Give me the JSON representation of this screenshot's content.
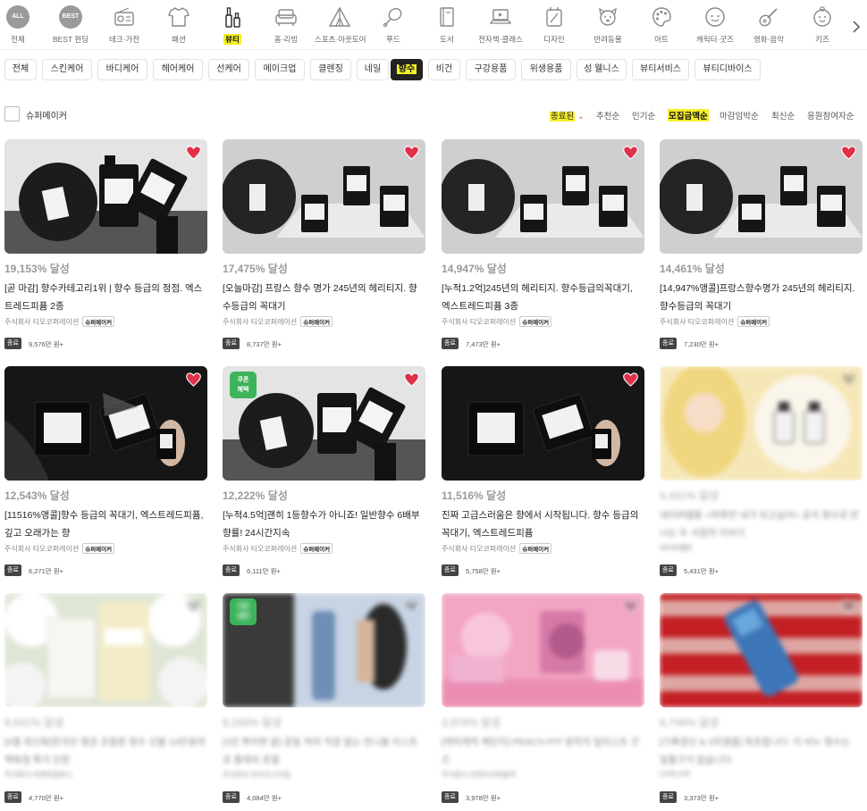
{
  "categories": [
    {
      "label": "전체",
      "icon": "all-icon"
    },
    {
      "label": "BEST 펀딩",
      "icon": "best-icon"
    },
    {
      "label": "테크·가전",
      "icon": "radio-icon"
    },
    {
      "label": "패션",
      "icon": "shirt-icon"
    },
    {
      "label": "뷰티",
      "icon": "cosmetics-icon",
      "active": true
    },
    {
      "label": "홈·리빙",
      "icon": "sofa-icon"
    },
    {
      "label": "스포츠·아웃도어",
      "icon": "tent-icon"
    },
    {
      "label": "푸드",
      "icon": "drumstick-icon"
    },
    {
      "label": "도서",
      "icon": "book-icon"
    },
    {
      "label": "전자책·클래스",
      "icon": "laptop-icon"
    },
    {
      "label": "디자인",
      "icon": "design-icon"
    },
    {
      "label": "반려동물",
      "icon": "dog-icon"
    },
    {
      "label": "아트",
      "icon": "palette-icon"
    },
    {
      "label": "캐릭터·굿즈",
      "icon": "character-icon"
    },
    {
      "label": "영화·음악",
      "icon": "guitar-icon"
    },
    {
      "label": "키즈",
      "icon": "kids-icon"
    }
  ],
  "all_badge": "ALL",
  "best_badge": "BEST",
  "subtabs": [
    "전체",
    "스킨케어",
    "바디케어",
    "헤어케어",
    "선케어",
    "메이크업",
    "클렌징",
    "네일",
    "향수",
    "비건",
    "구강용품",
    "위생용품",
    "성 웰니스",
    "뷰티서비스",
    "뷰티디바이스"
  ],
  "active_subtab": "향수",
  "filter": {
    "super_maker_label": "슈퍼메이커",
    "status_dropdown": "종료된",
    "sorts": [
      "추천순",
      "인기순",
      "모집금액순",
      "마감임박순",
      "최신순",
      "응원참여자순"
    ],
    "active_sort": "모집금액순"
  },
  "products": [
    {
      "pct": "19,153% 달성",
      "title": "[곧 마감] 향수카테고리1위 | 향수 등급의 정점. 엑스트레드피퓸 2종",
      "maker": "주식회사 티오코퍼레이션",
      "super": "슈퍼메이커",
      "status": "종료",
      "amount": "9,576만 원+",
      "liked": true
    },
    {
      "pct": "17,475% 달성",
      "title": "[오늘마감] 프랑스 향수 명가 245년의 헤리티지. 향수등급의 꼭대기",
      "maker": "주식회사 티오코퍼레이션",
      "super": "슈퍼메이커",
      "status": "종료",
      "amount": "8,737만 원+",
      "liked": true
    },
    {
      "pct": "14,947% 달성",
      "title": "[누적1.2억]245년의 헤리티지. 향수등급의꼭대기, 엑스트레드피퓸 3종",
      "maker": "주식회사 티오코퍼레이션",
      "super": "슈퍼메이커",
      "status": "종료",
      "amount": "7,473만 원+",
      "liked": true
    },
    {
      "pct": "14,461% 달성",
      "title": "[14,947%앵콜]프랑스향수명가 245년의 헤리티지. 향수등급의 꼭대기",
      "maker": "주식회사 티오코퍼레이션",
      "super": "슈퍼메이커",
      "status": "종료",
      "amount": "7,230만 원+",
      "liked": true
    },
    {
      "pct": "12,543% 달성",
      "title": "[11516%앵콜]향수 등급의 꼭대기, 엑스트레드피퓸, 깊고 오래가는 향",
      "maker": "주식회사 티오코퍼레이션",
      "super": "슈퍼메이커",
      "status": "종료",
      "amount": "6,271만 원+",
      "liked": true
    },
    {
      "pct": "12,222% 달성",
      "title": "[누적4.5억]괜히 1등향수가 아니죠! 일반향수 6배부향률! 24시간지속",
      "maker": "주식회사 티오코퍼레이션",
      "super": "슈퍼메이커",
      "status": "종료",
      "amount": "6,111만 원+",
      "liked": true,
      "coupon": "쿠폰\n혜택"
    },
    {
      "pct": "11,516% 달성",
      "title": "진짜 고급스러움은 향에서 시작됩니다. 향수 등급의 꼭대기, 엑스트레드피퓸",
      "maker": "주식회사 티오코퍼레이션",
      "super": "슈퍼메이커",
      "status": "종료",
      "amount": "5,758만 원+",
      "liked": true
    },
    {
      "pct": "5,431% 달성",
      "title": "네이버웹툰 <하루만 네가 되고싶어> 공식 향수로 만나는 두 사람의 이야기",
      "maker": "네이버웹툰",
      "super": "",
      "status": "종료",
      "amount": "5,431만 원+",
      "liked": false
    },
    {
      "pct": "9,541% 달성",
      "title": "[4월 최신화]한국인 평균 조말론 향수 선물 10만원대 백화점 특가 단판",
      "maker": "주식회사 비엔피컴퍼니",
      "super": "",
      "status": "종료",
      "amount": "4,770만 원+",
      "liked": false
    },
    {
      "pct": "8,168% 달성",
      "title": "[1만 뿌리면 끝] 운동 하러 직장 없는 언니들 이스트로 플레쉬 포멀",
      "maker": "주식회사 라이프스타일",
      "super": "",
      "status": "종료",
      "amount": "4,084만 원+",
      "liked": false,
      "coupon": "쿠폰\n혜택"
    },
    {
      "pct": "3,978% 달성",
      "title": "[캐릭캐릭 체인지] PEACH-PIT 원작자 일러스트 굿즈",
      "maker": "주식회사 콘텐츠리퍼블릭",
      "super": "",
      "status": "종료",
      "amount": "3,978만 원+",
      "liked": false
    },
    {
      "pct": "6,746% 달성",
      "title": "[기록경신 & 4차앵콜] 최초합니다. 이 비누 향수는 일품구가 없습니다.",
      "maker": "LIVELIVE",
      "super": "",
      "status": "종료",
      "amount": "3,373만 원+",
      "liked": false
    }
  ],
  "colors": {
    "accent_yellow": "#f5ee2a",
    "heart_red": "#e0314a",
    "coupon_green": "#3db35b"
  }
}
